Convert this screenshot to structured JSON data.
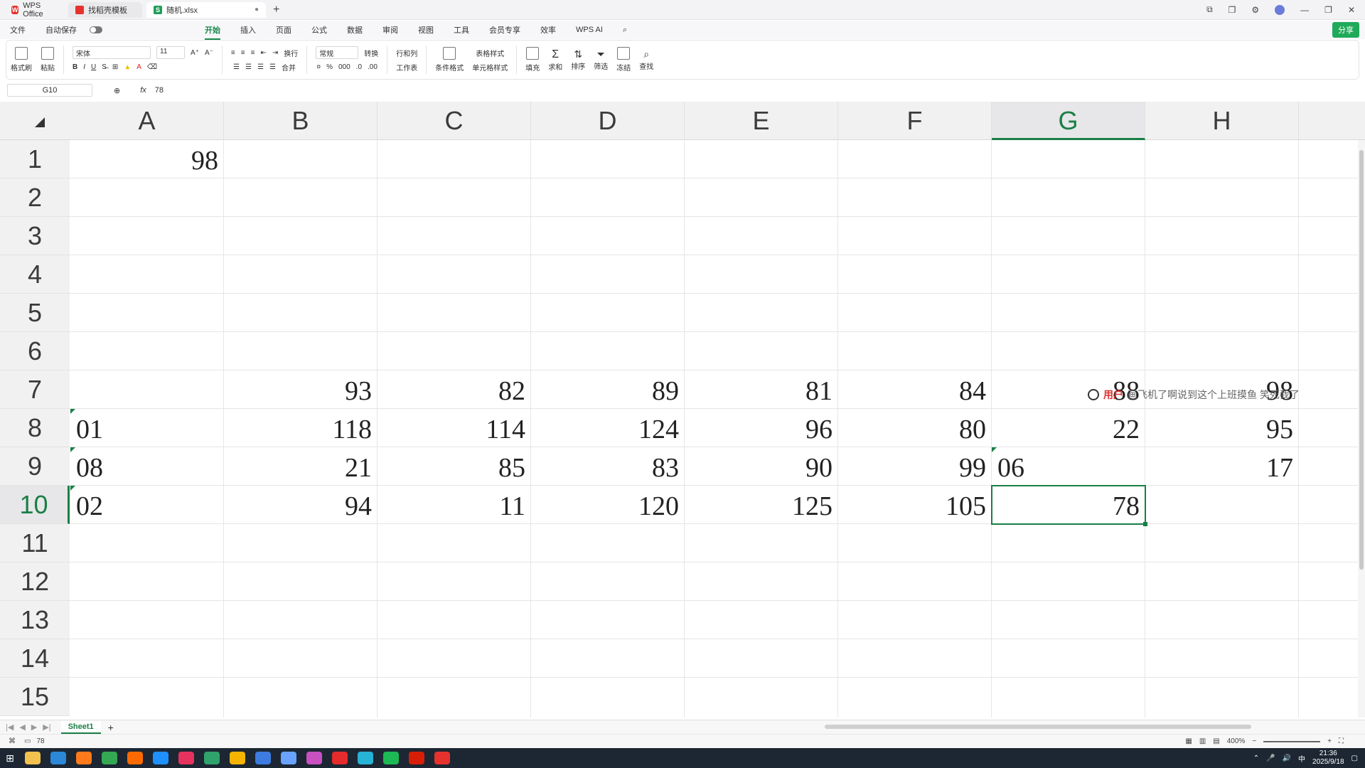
{
  "window": {
    "tabs": [
      {
        "label": "WPS Office"
      },
      {
        "label": "找稻壳模板"
      },
      {
        "label": "随机.xlsx"
      }
    ]
  },
  "menu": {
    "file": "文件",
    "autosave": "自动保存",
    "items": [
      "开始",
      "插入",
      "页面",
      "公式",
      "数据",
      "审阅",
      "视图",
      "工具",
      "会员专享",
      "效率"
    ],
    "ai": "WPS AI",
    "share": "分享"
  },
  "ribbon": {
    "format_brush": "格式刷",
    "paste": "粘贴",
    "font_name": "宋体",
    "font_size": "11",
    "wrap": "换行",
    "merge": "合并",
    "number_format": "常规",
    "convert": "转换",
    "rows_cols": "行和列",
    "worksheet": "工作表",
    "cond_format": "条件格式",
    "table_style": "表格样式",
    "cell_style": "单元格样式",
    "fill": "填充",
    "sum": "求和",
    "sort": "排序",
    "filter": "筛选",
    "freeze": "冻结",
    "find": "查找"
  },
  "formula_bar": {
    "cell_ref": "G10",
    "fx": "fx",
    "value": "78"
  },
  "columns": [
    "A",
    "B",
    "C",
    "D",
    "E",
    "F",
    "G",
    "H"
  ],
  "rows": [
    "1",
    "2",
    "3",
    "4",
    "5",
    "6",
    "7",
    "8",
    "9",
    "10",
    "11",
    "12",
    "13",
    "14",
    "15"
  ],
  "cells": {
    "r1": [
      "98",
      "",
      "",
      "",
      "",
      "",
      "",
      ""
    ],
    "r7": [
      "",
      "93",
      "82",
      "89",
      "81",
      "84",
      "88",
      "98"
    ],
    "r8": [
      "01",
      "118",
      "114",
      "124",
      "96",
      "80",
      "22",
      "95"
    ],
    "r9": [
      "08",
      "21",
      "85",
      "83",
      "90",
      "99",
      "06",
      "17"
    ],
    "r10": [
      "02",
      "94",
      "11",
      "120",
      "125",
      "105",
      "78",
      ""
    ]
  },
  "overlay": {
    "user": "用户",
    "message": "画飞机了啊说到这个上班摸鱼 笑死我了"
  },
  "sheet": {
    "tab": "Sheet1",
    "add": "+"
  },
  "status": {
    "cell_value": "78",
    "zoom": "400%"
  },
  "taskbar": {
    "time": "21:36",
    "date": "2025/9/18",
    "ime": "中"
  },
  "colors": {
    "accent": "#1a7f45",
    "wps_red": "#e5322d",
    "share_green": "#1faa59"
  }
}
